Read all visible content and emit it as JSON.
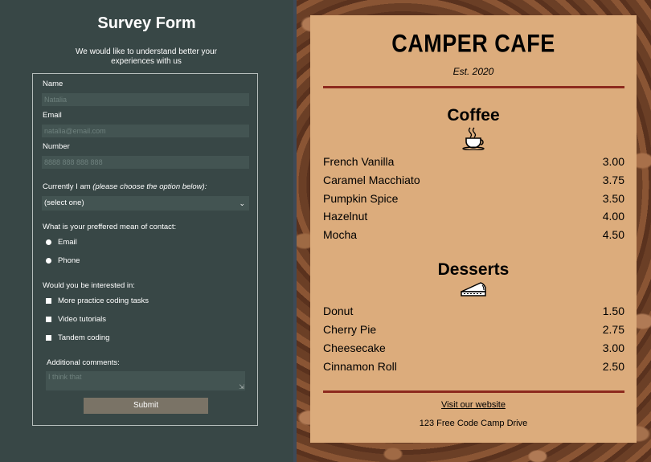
{
  "survey": {
    "title": "Survey Form",
    "description": "We would like to understand better your experiences with us",
    "name_label": "Name",
    "name_placeholder": "Natalia",
    "email_label": "Email",
    "email_placeholder": "natalia@email.com",
    "number_label": "Number",
    "number_placeholder": "8888 888 888 888",
    "current_label": "Currently I am",
    "current_hint": "(please choose the option below):",
    "current_selected": "(select one)",
    "contact_label": "What is your preffered mean of contact:",
    "contact_options": [
      "Email",
      "Phone"
    ],
    "interest_label": "Would you be interested in:",
    "interest_options": [
      "More practice coding tasks",
      "Video tutorials",
      "Tandem coding"
    ],
    "comments_label": "Additional comments:",
    "comments_placeholder": "I think that",
    "submit_label": "Submit"
  },
  "menu": {
    "title": "CAMPER CAFE",
    "established": "Est. 2020",
    "coffee": {
      "title": "Coffee",
      "icon": "coffee-cup-icon",
      "items": [
        {
          "name": "French Vanilla",
          "price": "3.00"
        },
        {
          "name": "Caramel Macchiato",
          "price": "3.75"
        },
        {
          "name": "Pumpkin Spice",
          "price": "3.50"
        },
        {
          "name": "Hazelnut",
          "price": "4.00"
        },
        {
          "name": "Mocha",
          "price": "4.50"
        }
      ]
    },
    "desserts": {
      "title": "Desserts",
      "icon": "pie-slice-icon",
      "items": [
        {
          "name": "Donut",
          "price": "1.50"
        },
        {
          "name": "Cherry Pie",
          "price": "2.75"
        },
        {
          "name": "Cheesecake",
          "price": "3.00"
        },
        {
          "name": "Cinnamon Roll",
          "price": "2.50"
        }
      ]
    },
    "website_link": "Visit our website",
    "address": "123 Free Code Camp Drive"
  },
  "colors": {
    "survey_bg": "#384746",
    "menu_bg": "#dcac7c",
    "rule": "#8d2a1e",
    "submit_bg": "#7a7366"
  }
}
